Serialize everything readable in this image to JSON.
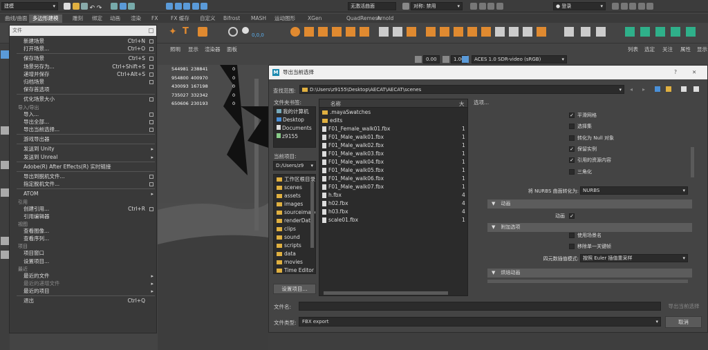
{
  "topbar": {
    "mode_dropdown": "建模",
    "live_surface": "无激活曲面",
    "symmetry": "对称: 禁用",
    "login": "登录"
  },
  "shelf_tabs": [
    "曲线/曲面",
    "多边形建模",
    "雕刻",
    "绑定",
    "动画",
    "渲染",
    "FX",
    "FX 缓存",
    "自定义",
    "Bifrost",
    "MASH",
    "运动图形",
    "XGen",
    "QuadRemesh",
    "Arnold"
  ],
  "shelf_xyz": "0,0,0",
  "panel_menu": [
    "照明",
    "显示",
    "渲染器",
    "面板"
  ],
  "right_menu": [
    "列表",
    "选定",
    "关注",
    "属性",
    "显示"
  ],
  "viewport": {
    "exposure": "0.00",
    "gamma": "1.00",
    "colorspace": "ACES 1.0 SDR-video (sRGB)",
    "stats": [
      [
        "544981",
        "238841",
        "0"
      ],
      [
        "954800",
        "400970",
        "0"
      ],
      [
        "430093",
        "167198",
        "0"
      ],
      [
        "735027",
        "332342",
        "0"
      ],
      [
        "650606",
        "230193",
        "0"
      ]
    ]
  },
  "file_menu": {
    "title": "文件",
    "items": [
      {
        "type": "item",
        "label": "新建场景",
        "shortcut": "Ctrl+N",
        "box": true
      },
      {
        "type": "item",
        "label": "打开场景...",
        "shortcut": "Ctrl+O",
        "box": true
      },
      {
        "type": "sep"
      },
      {
        "type": "item",
        "label": "保存场景",
        "shortcut": "Ctrl+S",
        "box": true
      },
      {
        "type": "item",
        "label": "场景另存为...",
        "shortcut": "Ctrl+Shift+S",
        "box": true
      },
      {
        "type": "item",
        "label": "递增并保存",
        "shortcut": "Ctrl+Alt+S",
        "box": true
      },
      {
        "type": "item",
        "label": "归档场景",
        "shortcut": "",
        "box": true
      },
      {
        "type": "item",
        "label": "保存首选项",
        "shortcut": "",
        "box": false
      },
      {
        "type": "sep"
      },
      {
        "type": "item",
        "label": "优化场景大小",
        "shortcut": "",
        "box": true
      },
      {
        "type": "header",
        "label": "导入/导出"
      },
      {
        "type": "item",
        "label": "导入...",
        "shortcut": "",
        "box": true
      },
      {
        "type": "item",
        "label": "导出全部...",
        "shortcut": "",
        "box": true
      },
      {
        "type": "item",
        "label": "导出当前选择...",
        "shortcut": "",
        "box": true
      },
      {
        "type": "sep"
      },
      {
        "type": "item",
        "label": "游戏导出器",
        "shortcut": "",
        "box": false
      },
      {
        "type": "sep"
      },
      {
        "type": "item",
        "label": "发送到 Unity",
        "shortcut": "",
        "arrow": true
      },
      {
        "type": "item",
        "label": "发送到 Unreal",
        "shortcut": "",
        "arrow": true
      },
      {
        "type": "sep"
      },
      {
        "type": "item",
        "label": "Adobe(R) After Effects(R) 实时链接",
        "shortcut": "",
        "box": false
      },
      {
        "type": "sep"
      },
      {
        "type": "item",
        "label": "导出到脱机文件...",
        "shortcut": "",
        "box": true
      },
      {
        "type": "item",
        "label": "指定脱机文件...",
        "shortcut": "",
        "box": true
      },
      {
        "type": "sep"
      },
      {
        "type": "item",
        "label": "ATOM",
        "shortcut": "",
        "arrow": true
      },
      {
        "type": "header",
        "label": "引用"
      },
      {
        "type": "item",
        "label": "创建引用...",
        "shortcut": "Ctrl+R",
        "box": true
      },
      {
        "type": "item",
        "label": "引用编辑器",
        "shortcut": "",
        "box": false
      },
      {
        "type": "header",
        "label": "视图"
      },
      {
        "type": "item",
        "label": "查看图像...",
        "shortcut": "",
        "box": false
      },
      {
        "type": "item",
        "label": "查看序列...",
        "shortcut": "",
        "box": false
      },
      {
        "type": "header",
        "label": "项目"
      },
      {
        "type": "item",
        "label": "项目窗口",
        "shortcut": "",
        "box": false
      },
      {
        "type": "item",
        "label": "设置项目...",
        "shortcut": "",
        "box": false
      },
      {
        "type": "header",
        "label": "最近"
      },
      {
        "type": "item",
        "label": "最近的文件",
        "shortcut": "",
        "arrow": true
      },
      {
        "type": "item",
        "label": "最近的递增文件",
        "shortcut": "",
        "arrow": true,
        "disabled": true
      },
      {
        "type": "item",
        "label": "最近的项目",
        "shortcut": "",
        "arrow": true
      },
      {
        "type": "sep"
      },
      {
        "type": "item",
        "label": "退出",
        "shortcut": "Ctrl+Q",
        "box": false
      }
    ]
  },
  "dialog": {
    "title": "导出当前选择",
    "help": "?",
    "close": "✕",
    "look_in_label": "查找范围:",
    "path": "D:\\Users\\z9155\\Desktop\\AECAT\\AECAT\\scenes",
    "bookmarks_label": "文件夹书签:",
    "bookmarks": [
      "我的计算机",
      "Desktop",
      "Documents",
      "z9155"
    ],
    "current_project_label": "当前项目:",
    "current_project": "D:/Users/z9",
    "project_folders": [
      "工作区根目录",
      "scenes",
      "assets",
      "images",
      "sourceimages",
      "renderData",
      "clips",
      "sound",
      "scripts",
      "data",
      "movies",
      "Time Editor"
    ],
    "set_project_button": "设置项目...",
    "col_name": "名称",
    "col_size": "大",
    "files": [
      {
        "name": ".mayaSwatches",
        "folder": true,
        "size": ""
      },
      {
        "name": "edits",
        "folder": true,
        "size": ""
      },
      {
        "name": "F01_Female_walk01.fbx",
        "folder": false,
        "size": "1"
      },
      {
        "name": "F01_Male_walk01.fbx",
        "folder": false,
        "size": "1"
      },
      {
        "name": "F01_Male_walk02.fbx",
        "folder": false,
        "size": "1"
      },
      {
        "name": "F01_Male_walk03.fbx",
        "folder": false,
        "size": "1"
      },
      {
        "name": "F01_Male_walk04.fbx",
        "folder": false,
        "size": "1"
      },
      {
        "name": "F01_Male_walk05.fbx",
        "folder": false,
        "size": "1"
      },
      {
        "name": "F01_Male_walk06.fbx",
        "folder": false,
        "size": "1"
      },
      {
        "name": "F01_Male_walk07.fbx",
        "folder": false,
        "size": "1"
      },
      {
        "name": "h.fbx",
        "folder": false,
        "size": "4"
      },
      {
        "name": "h02.fbx",
        "folder": false,
        "size": "4"
      },
      {
        "name": "h03.fbx",
        "folder": false,
        "size": "4"
      },
      {
        "name": "scale01.fbx",
        "folder": false,
        "size": "1"
      }
    ],
    "options_label": "选项...",
    "options": [
      {
        "label": "平滑网格",
        "checked": true
      },
      {
        "label": "选择集",
        "checked": false
      },
      {
        "label": "转化为 Null 对象",
        "checked": false
      },
      {
        "label": "保留实例",
        "checked": true
      },
      {
        "label": "引用的资源内容",
        "checked": true
      },
      {
        "label": "三角化",
        "checked": false
      }
    ],
    "nurbs_label": "将 NURBS 曲面转化为:",
    "nurbs_value": "NURBS",
    "section_animation": "动画",
    "animation_label": "动画",
    "animation_checked": true,
    "section_extra": "附加选项",
    "extra_options": [
      {
        "label": "使用场景名",
        "checked": false
      },
      {
        "label": "移除单一关键帧",
        "checked": false
      }
    ],
    "quat_label": "四元数插值模式:",
    "quat_value": "按照 Euler 插值重采样",
    "section_bake": "烘焙动画",
    "filename_label": "文件名:",
    "filename_value": "",
    "filetype_label": "文件类型:",
    "filetype_value": "FBX export",
    "export_button": "导出当前选择",
    "cancel_button": "取消"
  }
}
